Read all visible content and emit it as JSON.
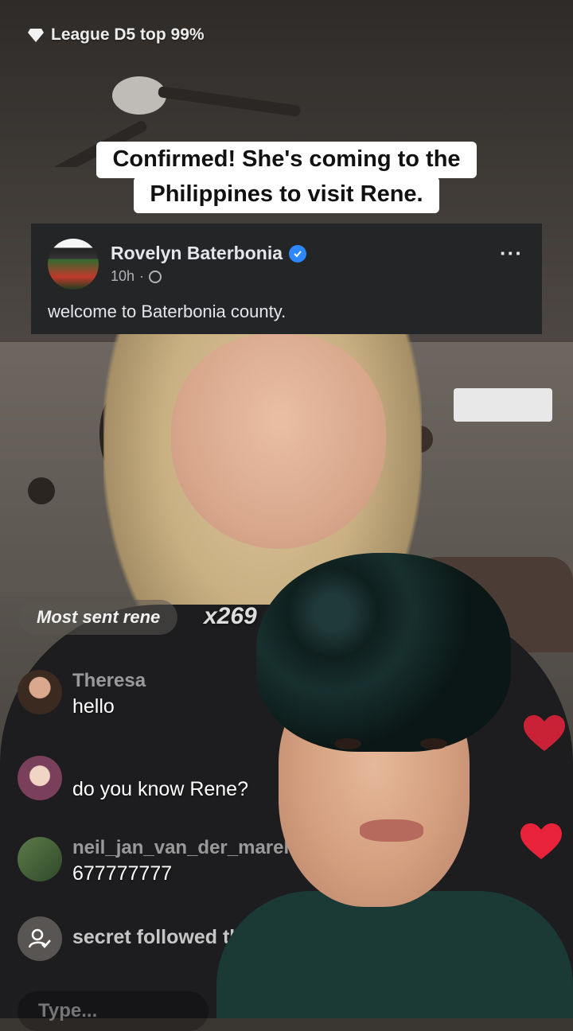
{
  "header": {
    "league_text": "League D5 top 99%"
  },
  "caption": {
    "line1": "Confirmed! She's coming to the",
    "line2": "Philippines to visit Rene."
  },
  "facebook_post": {
    "author": "Rovelyn Baterbonia",
    "time": "10h",
    "separator": "·",
    "more": "···",
    "text": "welcome to Baterbonia county."
  },
  "gift_banner": {
    "label": "Most sent rene",
    "count": "x269"
  },
  "chat": [
    {
      "user": "Theresa",
      "message": "hello"
    },
    {
      "user": "",
      "message": "do you know Rene?"
    },
    {
      "user": "neil_jan_van_der_marel-",
      "message": "677777777"
    }
  ],
  "follow_notice": {
    "text": "secret followed the"
  },
  "comment_input": {
    "placeholder": "Type..."
  },
  "colors": {
    "facebook_bg": "#242526",
    "verified": "#2d88ff",
    "heart": "#e8223a",
    "caption_bg": "#ffffff"
  }
}
